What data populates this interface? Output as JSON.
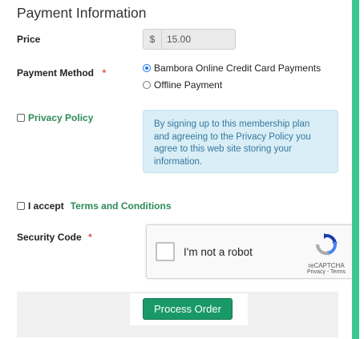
{
  "form": {
    "title": "Payment Information",
    "price": {
      "label": "Price",
      "currency_symbol": "$",
      "value": "15.00"
    },
    "payment_method": {
      "label": "Payment Method",
      "required_marker": "*",
      "options": [
        {
          "label": "Bambora Online Credit Card Payments",
          "selected": true
        },
        {
          "label": "Offline Payment",
          "selected": false
        }
      ]
    },
    "privacy": {
      "checkbox_label": "Privacy Policy",
      "notice": "By signing up to this membership plan and agreeing to the Privacy Policy you agree to this web site storing your information."
    },
    "terms": {
      "prefix": "I accept",
      "link": "Terms and Conditions"
    },
    "security": {
      "label": "Security Code",
      "required_marker": "*",
      "captcha": {
        "text": "I'm not a robot",
        "brand": "reCAPTCHA",
        "links": "Privacy - Terms"
      }
    },
    "submit_label": "Process Order"
  },
  "colors": {
    "accent_green": "#3cc693",
    "button_green": "#1a9968",
    "info_bg": "#d9eef7",
    "info_text": "#35789d"
  }
}
